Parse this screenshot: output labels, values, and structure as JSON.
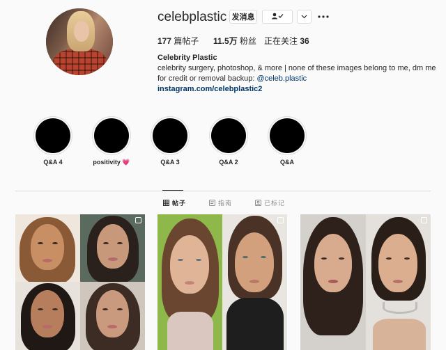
{
  "profile": {
    "username": "celebplastic",
    "message_button": "发消息",
    "posts_count": "177",
    "posts_label": "篇帖子",
    "followers_count": "11.5万",
    "followers_label": "粉丝",
    "following_label": "正在关注",
    "following_count": "36",
    "display_name": "Celebrity Plastic",
    "bio_line1": "celebrity surgery, photoshop, & more | none of these images belong to me, dm me",
    "bio_line2_prefix": "for credit or removal backup: ",
    "bio_mention": "@celeb.plastic",
    "bio_link": "instagram.com/celebplastic2"
  },
  "highlights": [
    {
      "label": "Q&A 4"
    },
    {
      "label": "positivity",
      "emoji": "💗"
    },
    {
      "label": "Q&A 3"
    },
    {
      "label": "Q&A 2"
    },
    {
      "label": "Q&A"
    }
  ],
  "tabs": [
    {
      "label": "帖子",
      "icon": "grid-icon",
      "active": true
    },
    {
      "label": "指南",
      "icon": "guide-icon",
      "active": false
    },
    {
      "label": "已标记",
      "icon": "tag-icon",
      "active": false
    }
  ],
  "icons": {
    "follow": "person-check-icon",
    "dropdown": "chevron-down-icon",
    "more": "more-options-icon",
    "multi_post": "multiple-posts-icon"
  },
  "colors": {
    "background": "#fafafa",
    "text": "#262626",
    "link": "#00376b",
    "muted": "#8e8e8e",
    "border": "#dbdbdb"
  }
}
